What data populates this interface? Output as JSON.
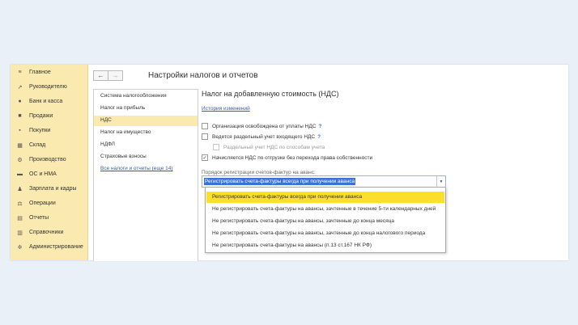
{
  "sidebar": {
    "items": [
      {
        "label": "Главное",
        "icon": "menu-icon"
      },
      {
        "label": "Руководителю",
        "icon": "trend-icon"
      },
      {
        "label": "Банк и касса",
        "icon": "coin-icon"
      },
      {
        "label": "Продажи",
        "icon": "cart-icon"
      },
      {
        "label": "Покупки",
        "icon": "basket-icon"
      },
      {
        "label": "Склад",
        "icon": "warehouse-icon"
      },
      {
        "label": "Производство",
        "icon": "factory-icon"
      },
      {
        "label": "ОС и НМА",
        "icon": "truck-icon"
      },
      {
        "label": "Зарплата и кадры",
        "icon": "people-icon"
      },
      {
        "label": "Операции",
        "icon": "scales-icon"
      },
      {
        "label": "Отчеты",
        "icon": "report-icon"
      },
      {
        "label": "Справочники",
        "icon": "book-icon"
      },
      {
        "label": "Администрирование",
        "icon": "gear-icon"
      }
    ]
  },
  "toolbar": {
    "back": "←",
    "forward": "→"
  },
  "page_title": "Настройки налогов и отчетов",
  "left_panel": {
    "items": [
      {
        "label": "Система налогообложения"
      },
      {
        "label": "Налог на прибыль"
      },
      {
        "label": "НДС"
      },
      {
        "label": "Налог на имущество"
      },
      {
        "label": "НДФЛ"
      },
      {
        "label": "Страховые взносы"
      }
    ],
    "all_link": "Все налоги и отчеты (еще 14)"
  },
  "section": {
    "title": "Налог на добавленную стоимость (НДС)",
    "history_link": "История изменений",
    "checkboxes": [
      {
        "label": "Организация освобождена от уплаты НДС",
        "checked": false,
        "help": "?"
      },
      {
        "label": "Ведется раздельный учет входящего НДС",
        "checked": false,
        "help": "?"
      },
      {
        "label": "Раздельный учет НДС по способам учета",
        "checked": false,
        "disabled": true
      },
      {
        "label": "Начисляется НДС по отгрузке без перехода права собственности",
        "checked": true
      }
    ],
    "field_label": "Порядок регистрации счетов-фактур на аванс:",
    "field_value": "Регистрировать счета-фактуры всегда при получении аванса",
    "options": [
      "Регистрировать счета-фактуры всегда при получении аванса",
      "Не регистрировать счета-фактуры на авансы, зачтенные в течение 5-ти календарных дней",
      "Не регистрировать счета-фактуры на авансы, зачтенные до конца месяца",
      "Не регистрировать счета-фактуры на авансы, зачтенные до конца налогового периода",
      "Не регистрировать счета-фактуры на авансы (п.13 ст.167 НК РФ)"
    ]
  },
  "colors": {
    "sidebar_bg": "#fbeab0",
    "selected_option": "#fbdf2b",
    "link": "#3a5aa8"
  }
}
